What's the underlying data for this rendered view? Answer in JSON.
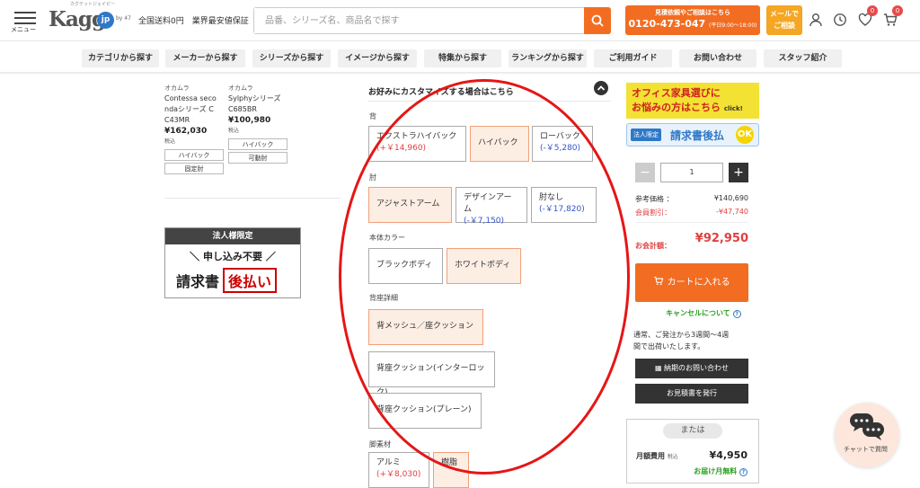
{
  "header": {
    "menu_label": "メニュー",
    "logo": "Kagg",
    "logo_badge": "jp",
    "logo_sub": "カグテットジェイピー",
    "logo_by": "by 47",
    "shipping_text": "全国送料0円　業界最安値保証",
    "search_placeholder": "品番、シリーズ名、商品名で探す",
    "phone_caption": "見積依頼やご相談はこちら",
    "phone_number": "0120-473-047",
    "phone_hours": "(平日9:00〜18:00)",
    "mail_label_1": "メールで",
    "mail_label_2": "ご相談",
    "favorites_count": "0",
    "cart_count": "0"
  },
  "nav": {
    "items": [
      "カテゴリから探す",
      "メーカーから探す",
      "シリーズから探す",
      "イメージから探す",
      "特集から探す",
      "ランキングから探す",
      "ご利用ガイド",
      "お問い合わせ",
      "スタッフ紹介"
    ]
  },
  "products": [
    {
      "maker": "オカムラ",
      "name_1": "Contessa seco",
      "name_2": "ndaシリーズ C",
      "name_3": "C43MR",
      "price": "¥162,030",
      "tax": "税込",
      "tag1": "ハイバック",
      "tag2": "固定肘"
    },
    {
      "maker": "オカムラ",
      "name_1": "Sylphyシリーズ",
      "name_2": "C685BR",
      "name_3": "",
      "price": "¥100,980",
      "tax": "税込",
      "tag1": "ハイバック",
      "tag2": "可動肘"
    }
  ],
  "corp_banner": {
    "title": "法人様限定",
    "main": "＼ 申し込み不要 ／",
    "doc": "請求書",
    "pay": "後払い"
  },
  "customize": {
    "heading": "お好みにカスタマイズする場合はこちら",
    "sections": {
      "back": {
        "label": "背",
        "options": [
          {
            "name": "エクストラハイバック",
            "price": "(+￥14,960)"
          },
          {
            "name": "ハイバック",
            "price": ""
          },
          {
            "name": "ローバック",
            "price": "(-￥5,280)"
          }
        ]
      },
      "arm": {
        "label": "肘",
        "options": [
          {
            "name": "アジャストアーム",
            "price": ""
          },
          {
            "name": "デザインアーム",
            "price": "(-￥7,150)"
          },
          {
            "name": "肘なし",
            "price": "(-￥17,820)"
          }
        ]
      },
      "body_color": {
        "label": "本体カラー",
        "options": [
          {
            "name": "ブラックボディ",
            "price": ""
          },
          {
            "name": "ホワイトボディ",
            "price": ""
          }
        ]
      },
      "seat": {
        "label": "背座詳細",
        "options": [
          {
            "name": "背メッシュ／座クッション",
            "price": ""
          },
          {
            "name": "背座クッション(インターロック)",
            "price": ""
          },
          {
            "name": "背座クッション(プレーン)",
            "price": ""
          }
        ]
      },
      "leg": {
        "label": "脚素材",
        "options": [
          {
            "name": "アルミ",
            "price": "(+￥8,030)"
          },
          {
            "name": "樹脂",
            "price": ""
          }
        ]
      }
    }
  },
  "sidebar": {
    "banner_1": "オフィス家具選びに",
    "banner_2": "お悩みの方はこちら",
    "banner_click": "click!",
    "corp_chip": "法人限定",
    "invoice": "請求書後払",
    "ok": "OK",
    "qty": "1",
    "ref_label": "参考価格 ：",
    "ref_value": "¥140,690",
    "discount_label": "会員割引：",
    "discount_value": "-¥47,740",
    "total_label": "お会計額：",
    "total_value": "¥92,950",
    "cart_button": "カートに入れる",
    "cancel_link": "キャンセルについて",
    "delivery_1": "通常、ご発注から3週間〜4週",
    "delivery_2": "間で出荷いたします。",
    "inquiry_button": "納期のお問い合わせ",
    "quote_button": "お見積書を発行",
    "or_label": "または",
    "monthly_label": "月額費用",
    "monthly_tax": "税込",
    "monthly_value": "¥4,950",
    "monthly_free": "お届け月無料"
  },
  "chat": {
    "label": "チャットで質問"
  },
  "colors": {
    "accent": "#f26d21",
    "annotation_circle": "#e51616",
    "price_red": "#e04040",
    "green": "#2aa020",
    "selected_bg": "#fdeee4"
  }
}
